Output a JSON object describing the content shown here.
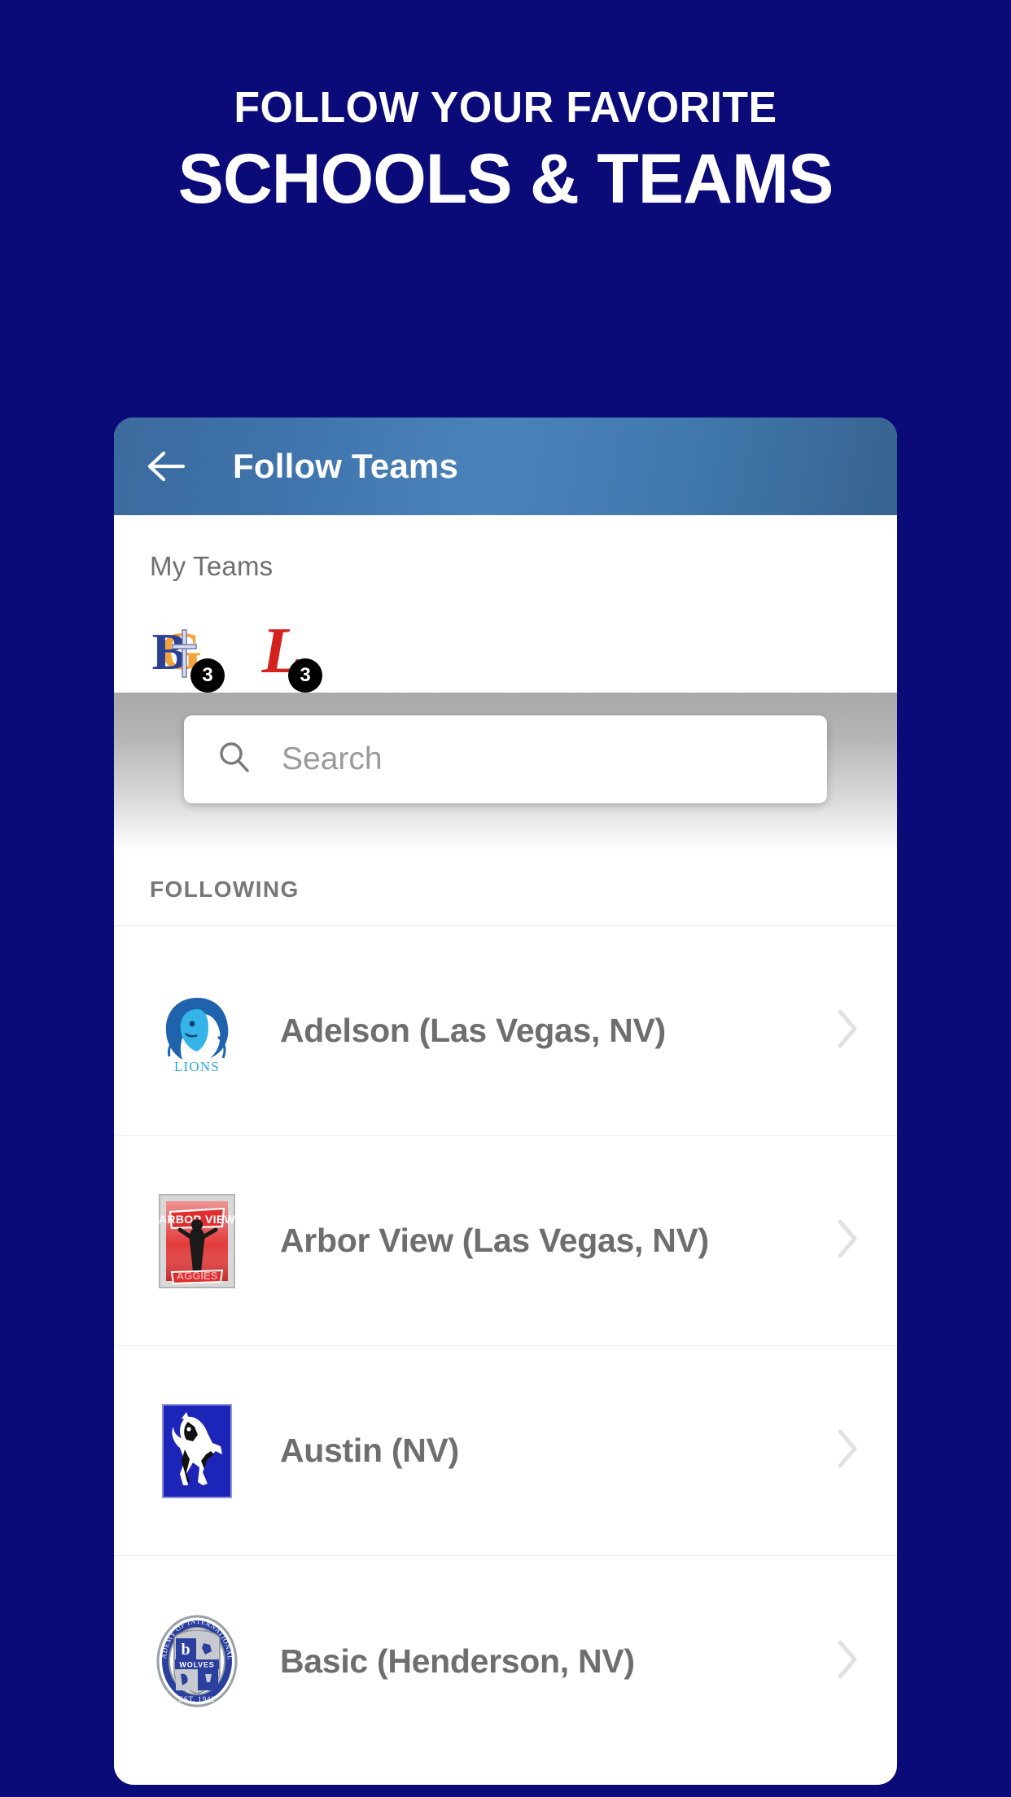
{
  "promo": {
    "line1": "FOLLOW YOUR FAVORITE",
    "line2": "SCHOOLS & TEAMS",
    "background_color": "#0a0a78",
    "text_color": "#ffffff"
  },
  "appbar": {
    "back_icon": "arrow-left-icon",
    "title": "Follow Teams",
    "gradient_from": "#3b6a9e",
    "gradient_to": "#376390",
    "title_color": "#ffffff"
  },
  "my_teams": {
    "label": "My Teams",
    "chips": [
      {
        "name": "BG",
        "badge": "3",
        "logo_icon": "bg-cross-logo"
      },
      {
        "name": "L",
        "badge": "3",
        "logo_icon": "l-script-logo"
      }
    ],
    "badge_bg": "#000000",
    "badge_color": "#ffffff"
  },
  "search": {
    "icon": "search-icon",
    "placeholder": "Search",
    "value": "",
    "placeholder_color": "#9a9a9a"
  },
  "following": {
    "header": "FOLLOWING",
    "header_color": "#787878",
    "items": [
      {
        "label": "Adelson (Las Vegas, NV)",
        "logo_icon": "lion-head-logo",
        "logo_caption": "LIONS",
        "chevron": "chevron-right-icon"
      },
      {
        "label": "Arbor View (Las Vegas, NV)",
        "logo_icon": "arbor-view-aggies-logo",
        "logo_caption": "AGGIES",
        "chevron": "chevron-right-icon"
      },
      {
        "label": "Austin (NV)",
        "logo_icon": "mustang-horse-logo",
        "logo_caption": "",
        "chevron": "chevron-right-icon"
      },
      {
        "label": "Basic (Henderson, NV)",
        "logo_icon": "basic-wolves-seal-logo",
        "logo_caption": "WOLVES",
        "chevron": "chevron-right-icon"
      }
    ]
  }
}
